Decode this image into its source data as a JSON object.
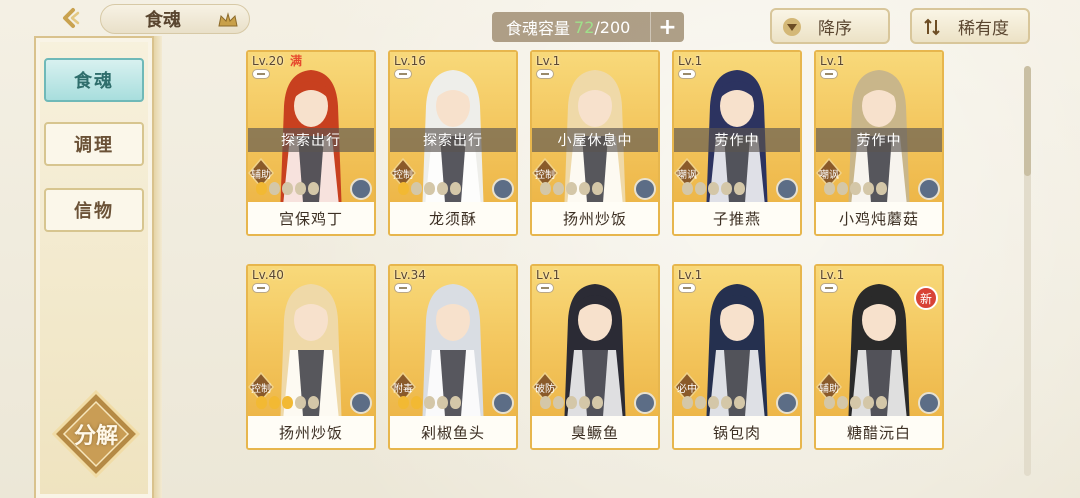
{
  "header": {
    "title": "食魂",
    "capacity_label": "食魂容量",
    "capacity_current": "72",
    "capacity_sep": "/200",
    "add_symbol": "+"
  },
  "sort": {
    "order_label": "降序",
    "rarity_label": "稀有度"
  },
  "sidebar": {
    "tabs": [
      {
        "label": "食魂",
        "active": true
      },
      {
        "label": "调理",
        "active": false
      },
      {
        "label": "信物",
        "active": false
      }
    ],
    "decompose_label": "分解"
  },
  "cards": [
    {
      "level": "Lv.20",
      "mark": "满",
      "status": "探索出行",
      "role": "辅助",
      "stars": 1,
      "name": "宫保鸡丁",
      "badge": "",
      "hair": "#c8401f"
    },
    {
      "level": "Lv.16",
      "mark": "",
      "status": "探索出行",
      "role": "控制",
      "stars": 1,
      "name": "龙须酥",
      "badge": "",
      "hair": "#eeeeea"
    },
    {
      "level": "Lv.1",
      "mark": "",
      "status": "小屋休息中",
      "role": "控制",
      "stars": 0,
      "name": "扬州炒饭",
      "badge": "",
      "hair": "#efd9a8"
    },
    {
      "level": "Lv.1",
      "mark": "",
      "status": "劳作中",
      "role": "嘲讽",
      "stars": 0,
      "name": "子推燕",
      "badge": "",
      "hair": "#2c3360"
    },
    {
      "level": "Lv.1",
      "mark": "",
      "status": "劳作中",
      "role": "嘲讽",
      "stars": 0,
      "name": "小鸡炖蘑菇",
      "badge": "",
      "hair": "#c9b68a"
    },
    {
      "level": "Lv.40",
      "mark": "",
      "status": "",
      "role": "控制",
      "stars": 3,
      "name": "扬州炒饭",
      "badge": "",
      "hair": "#efd9a8"
    },
    {
      "level": "Lv.34",
      "mark": "",
      "status": "",
      "role": "附毒",
      "stars": 2,
      "name": "剁椒鱼头",
      "badge": "",
      "hair": "#d9dde3"
    },
    {
      "level": "Lv.1",
      "mark": "",
      "status": "",
      "role": "破防",
      "stars": 0,
      "name": "臭鳜鱼",
      "badge": "",
      "hair": "#2b2b35"
    },
    {
      "level": "Lv.1",
      "mark": "",
      "status": "",
      "role": "必中",
      "stars": 0,
      "name": "锅包肉",
      "badge": "",
      "hair": "#25304f"
    },
    {
      "level": "Lv.1",
      "mark": "",
      "status": "",
      "role": "辅助",
      "stars": 0,
      "name": "糖醋沅白",
      "badge": "新",
      "hair": "#2a2a2a"
    }
  ]
}
